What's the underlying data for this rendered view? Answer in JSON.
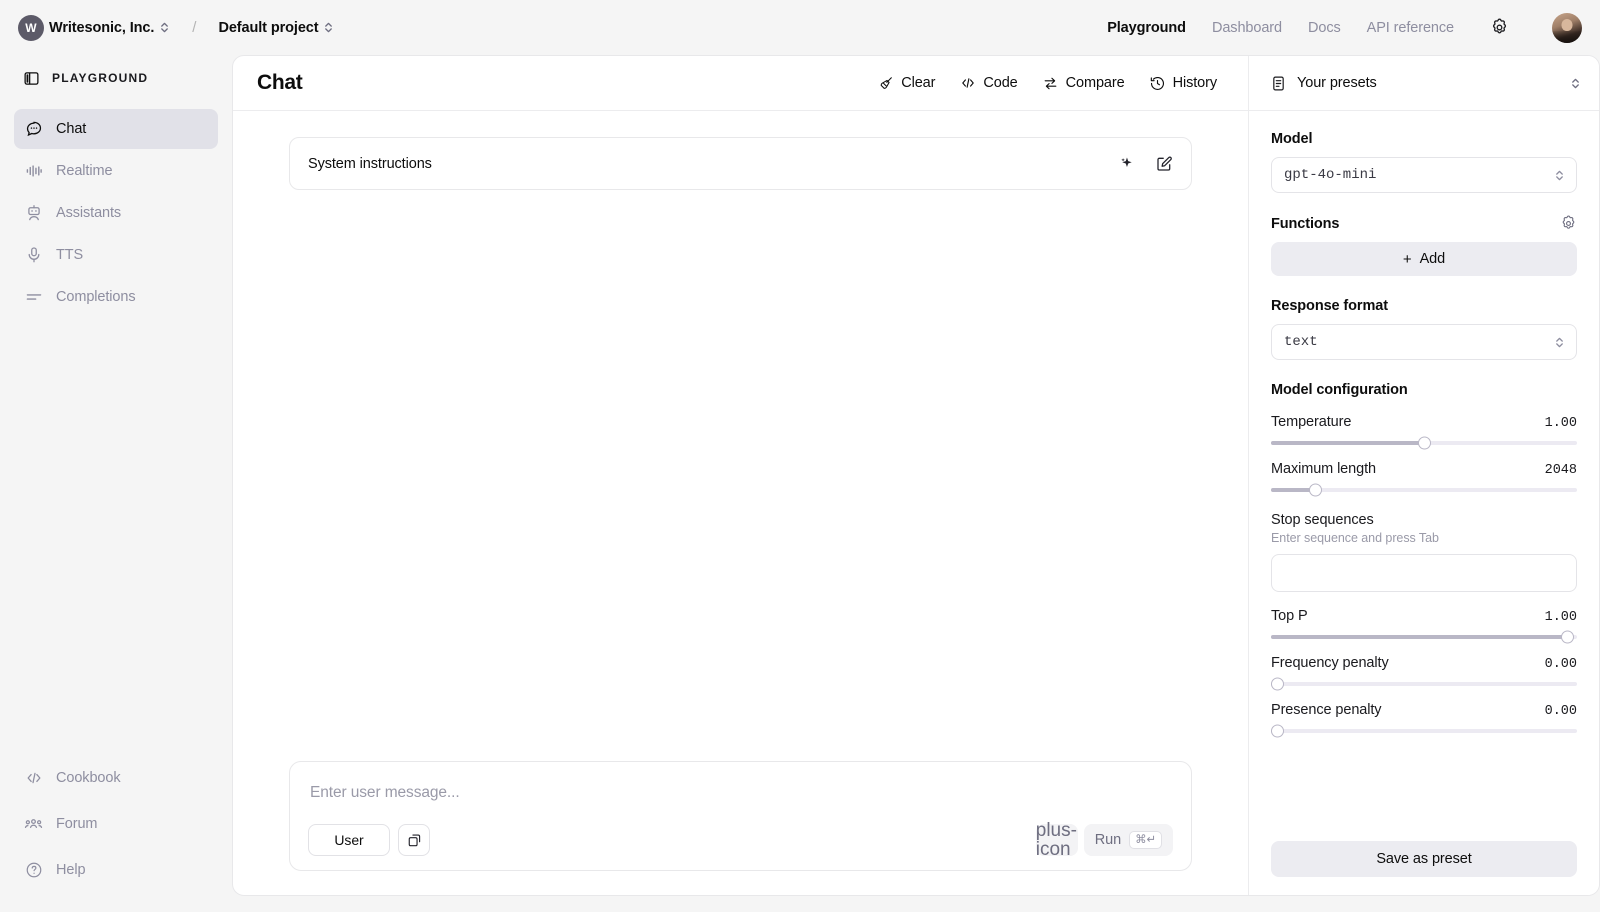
{
  "topbar": {
    "org": {
      "avatar_initial": "W",
      "name": "Writesonic, Inc."
    },
    "separator": "/",
    "project": {
      "name": "Default project"
    },
    "nav": [
      {
        "label": "Playground",
        "active": true
      },
      {
        "label": "Dashboard",
        "active": false
      },
      {
        "label": "Docs",
        "active": false
      },
      {
        "label": "API reference",
        "active": false
      }
    ],
    "settings_icon": "gear-icon",
    "avatar_icon": "user-avatar"
  },
  "sidebar": {
    "header": {
      "label": "PLAYGROUND",
      "icon": "panel-toggle-icon"
    },
    "items": [
      {
        "label": "Chat",
        "icon": "chat-bubble-icon",
        "active": true
      },
      {
        "label": "Realtime",
        "icon": "audio-waveform-icon",
        "active": false
      },
      {
        "label": "Assistants",
        "icon": "robot-icon",
        "active": false
      },
      {
        "label": "TTS",
        "icon": "microphone-icon",
        "active": false
      },
      {
        "label": "Completions",
        "icon": "lines-icon",
        "active": false
      }
    ],
    "bottom_items": [
      {
        "label": "Cookbook",
        "icon": "code-brackets-icon"
      },
      {
        "label": "Forum",
        "icon": "people-icon"
      },
      {
        "label": "Help",
        "icon": "question-circle-icon"
      }
    ]
  },
  "chat": {
    "title": "Chat",
    "actions": [
      {
        "label": "Clear",
        "icon": "broom-icon"
      },
      {
        "label": "Code",
        "icon": "code-brackets-icon"
      },
      {
        "label": "Compare",
        "icon": "compare-arrows-icon"
      },
      {
        "label": "History",
        "icon": "clock-history-icon"
      }
    ],
    "system": {
      "placeholder": "System instructions",
      "value": "",
      "generate_icon": "sparkle-icon",
      "edit_icon": "pencil-square-icon"
    },
    "composer": {
      "placeholder": "Enter user message...",
      "value": "",
      "role_label": "User",
      "copy_icon": "duplicate-icon",
      "add_icon": "plus-icon",
      "run_label": "Run",
      "run_shortcut": "⌘↵"
    }
  },
  "right_panel": {
    "presets": {
      "label": "Your presets",
      "icon": "preset-list-icon",
      "chevron": "chevron-updown-icon"
    },
    "model": {
      "label": "Model",
      "value": "gpt-4o-mini"
    },
    "functions": {
      "label": "Functions",
      "settings_icon": "gear-icon",
      "add_label": "Add",
      "add_plus": "+"
    },
    "response_format": {
      "label": "Response format",
      "value": "text"
    },
    "model_configuration": {
      "label": "Model configuration",
      "sliders": [
        {
          "name": "Temperature",
          "value": "1.00",
          "percent": 50
        },
        {
          "name": "Maximum length",
          "value": "2048",
          "percent": 14.5
        },
        {
          "name": "Top P",
          "value": "1.00",
          "percent": 97
        },
        {
          "name": "Frequency penalty",
          "value": "0.00",
          "percent": 2
        },
        {
          "name": "Presence penalty",
          "value": "0.00",
          "percent": 2
        }
      ]
    },
    "stop_sequences": {
      "label": "Stop sequences",
      "hint": "Enter sequence and press Tab",
      "value": "",
      "placeholder": ""
    },
    "save_preset_label": "Save as preset"
  }
}
